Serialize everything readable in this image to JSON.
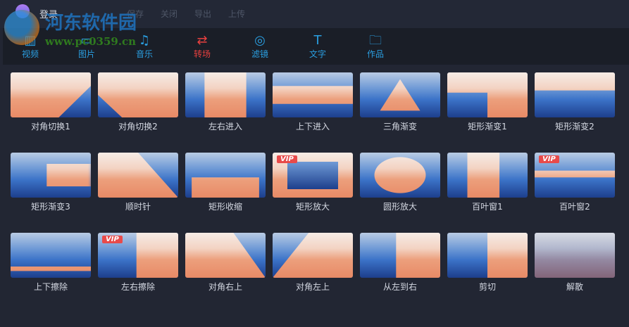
{
  "topbar": {
    "login": "登录",
    "menu": [
      "保存",
      "关闭",
      "导出",
      "上传"
    ]
  },
  "watermark": {
    "title": "河东软件园",
    "url": "www.pc0359.cn"
  },
  "toolbar": [
    {
      "label": "视频",
      "icon": "film-icon"
    },
    {
      "label": "图片",
      "icon": "image-icon"
    },
    {
      "label": "音乐",
      "icon": "music-icon"
    },
    {
      "label": "转场",
      "icon": "transition-icon",
      "active": true
    },
    {
      "label": "滤镜",
      "icon": "filter-icon"
    },
    {
      "label": "文字",
      "icon": "text-icon"
    },
    {
      "label": "作品",
      "icon": "folder-icon"
    }
  ],
  "vip_badge": "VIP",
  "transitions": [
    {
      "label": "对角切换1"
    },
    {
      "label": "对角切换2"
    },
    {
      "label": "左右进入"
    },
    {
      "label": "上下进入"
    },
    {
      "label": "三角渐变"
    },
    {
      "label": "矩形渐变1"
    },
    {
      "label": "矩形渐变2"
    },
    {
      "label": "矩形渐变3"
    },
    {
      "label": "顺时针"
    },
    {
      "label": "矩形收缩"
    },
    {
      "label": "矩形放大",
      "vip": true
    },
    {
      "label": "圆形放大"
    },
    {
      "label": "百叶窗1"
    },
    {
      "label": "百叶窗2",
      "vip": true
    },
    {
      "label": "上下擦除"
    },
    {
      "label": "左右擦除",
      "vip": true
    },
    {
      "label": "对角右上"
    },
    {
      "label": "对角左上"
    },
    {
      "label": "从左到右"
    },
    {
      "label": "剪切"
    },
    {
      "label": "解散"
    }
  ]
}
